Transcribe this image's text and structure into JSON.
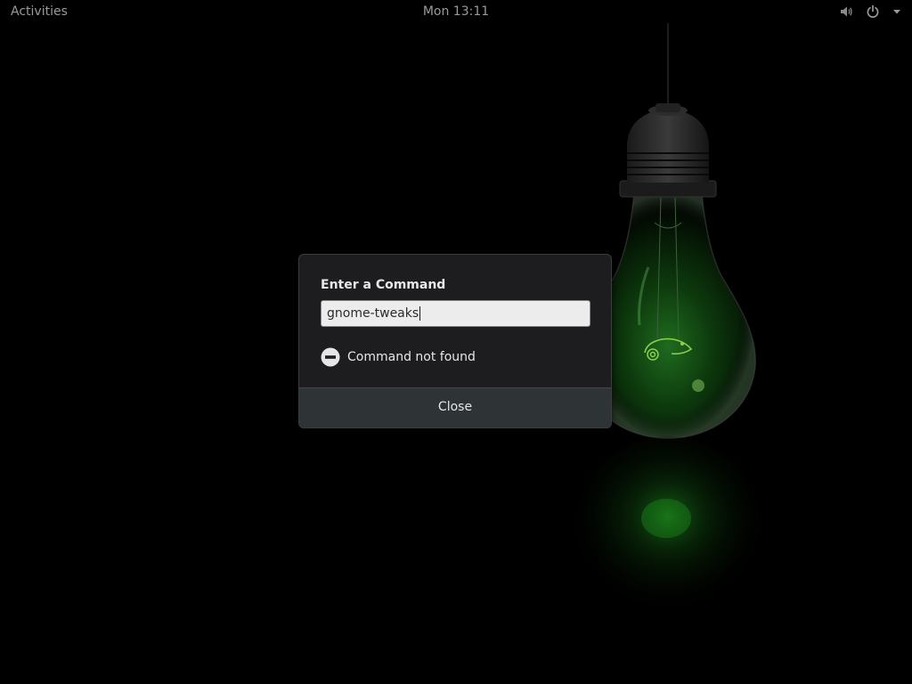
{
  "topbar": {
    "activities_label": "Activities",
    "clock": "Mon 13:11",
    "volume_icon": "volume-icon",
    "power_icon": "power-icon",
    "menu_icon": "chevron-down-icon"
  },
  "wallpaper": {
    "description_icon": "lightbulb-wallpaper",
    "accent_color": "#2fb52f",
    "logo_icon": "chameleon-logo-icon"
  },
  "dialog": {
    "title": "Enter a Command",
    "input_value": "gnome-tweaks",
    "error_icon": "error-icon",
    "error_text": "Command not found",
    "close_label": "Close"
  }
}
